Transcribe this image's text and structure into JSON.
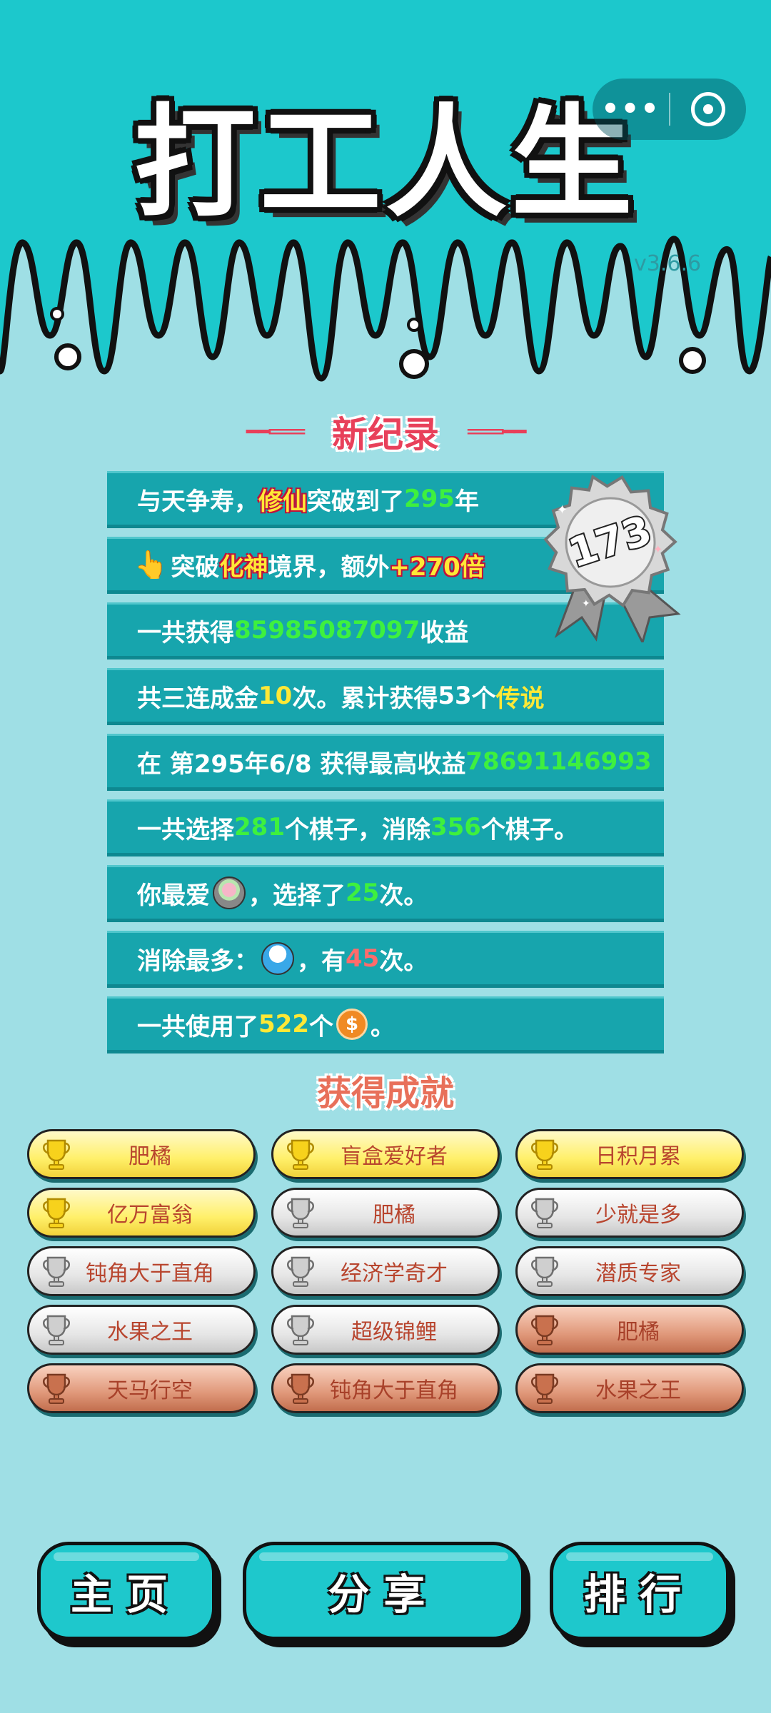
{
  "app": {
    "title": "打工人生",
    "version": "v3.6.6",
    "capsule_more": "•••"
  },
  "record": {
    "section_title": "新纪录",
    "badge_number": "173",
    "rows": [
      {
        "a": "与天争寿，",
        "hl": "修仙",
        "b": "突破到了",
        "num": "295",
        "c": "年"
      },
      {
        "hand": "👆",
        "a": "突破",
        "hl": "化神",
        "b": "境界，额外",
        "bonus": "+270倍"
      },
      {
        "a": "一共获得",
        "num": "85985087097",
        "b": "收益"
      },
      {
        "a": "共三连成金",
        "num": "10",
        "b": "次。累计获得",
        "num2": "53",
        "c": "个",
        "legend": "传说"
      },
      {
        "a": "在 第295年6/8 获得最高收益",
        "num": "78691146993"
      },
      {
        "a": "一共选择",
        "num": "281",
        "b": "个棋子，消除",
        "num2": "356",
        "c": "个棋子。"
      },
      {
        "a": "你最爱",
        "b": "，选择了",
        "num": "25",
        "c": "次。"
      },
      {
        "a": "消除最多：",
        "b": "，有",
        "num": "45",
        "c": "次。"
      },
      {
        "a": "一共使用了",
        "num": "522",
        "b": "个",
        "coin": "$",
        "c": "。"
      }
    ]
  },
  "achievements": {
    "title": "获得成就",
    "items": [
      {
        "label": "肥橘",
        "tier": "gold"
      },
      {
        "label": "盲盒爱好者",
        "tier": "gold"
      },
      {
        "label": "日积月累",
        "tier": "gold"
      },
      {
        "label": "亿万富翁",
        "tier": "gold"
      },
      {
        "label": "肥橘",
        "tier": "silver"
      },
      {
        "label": "少就是多",
        "tier": "silver"
      },
      {
        "label": "钝角大于直角",
        "tier": "silver"
      },
      {
        "label": "经济学奇才",
        "tier": "silver"
      },
      {
        "label": "潜质专家",
        "tier": "silver"
      },
      {
        "label": "水果之王",
        "tier": "silver"
      },
      {
        "label": "超级锦鲤",
        "tier": "silver"
      },
      {
        "label": "肥橘",
        "tier": "bronze"
      },
      {
        "label": "天马行空",
        "tier": "bronze"
      },
      {
        "label": "钝角大于直角",
        "tier": "bronze"
      },
      {
        "label": "水果之王",
        "tier": "bronze"
      }
    ]
  },
  "nav": {
    "home": "主页",
    "share": "分享",
    "rank": "排行"
  },
  "colors": {
    "header_bg": "#1cc8cc",
    "page_bg": "#9fdfe5",
    "row_bg": "#17a5ad",
    "accent_red": "#e8405a",
    "value_green": "#3ef03e",
    "value_yellow": "#ffe836"
  }
}
